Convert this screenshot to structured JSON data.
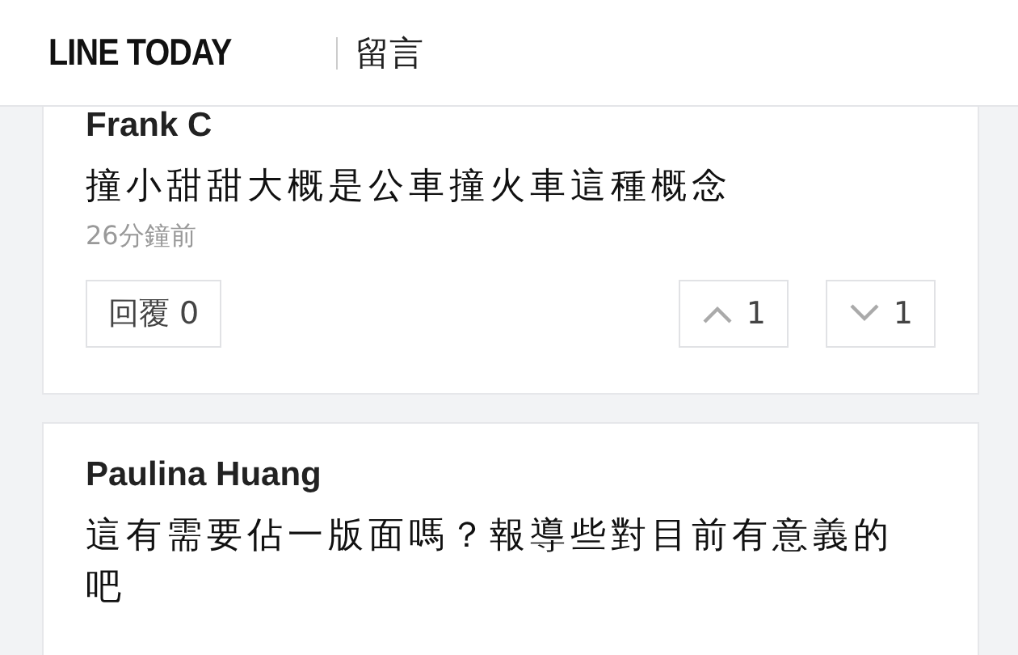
{
  "header": {
    "logo": "LINE TODAY",
    "section": "留言"
  },
  "comments": [
    {
      "name": "Frank C",
      "text": "撞小甜甜大概是公車撞火車這種概念",
      "time": "26分鐘前",
      "reply": {
        "label": "回覆",
        "count": "0"
      },
      "upvotes": "1",
      "downvotes": "1"
    },
    {
      "name": "Paulina Huang",
      "text": "這有需要佔一版面嗎？報導些對目前有意義的吧"
    }
  ]
}
